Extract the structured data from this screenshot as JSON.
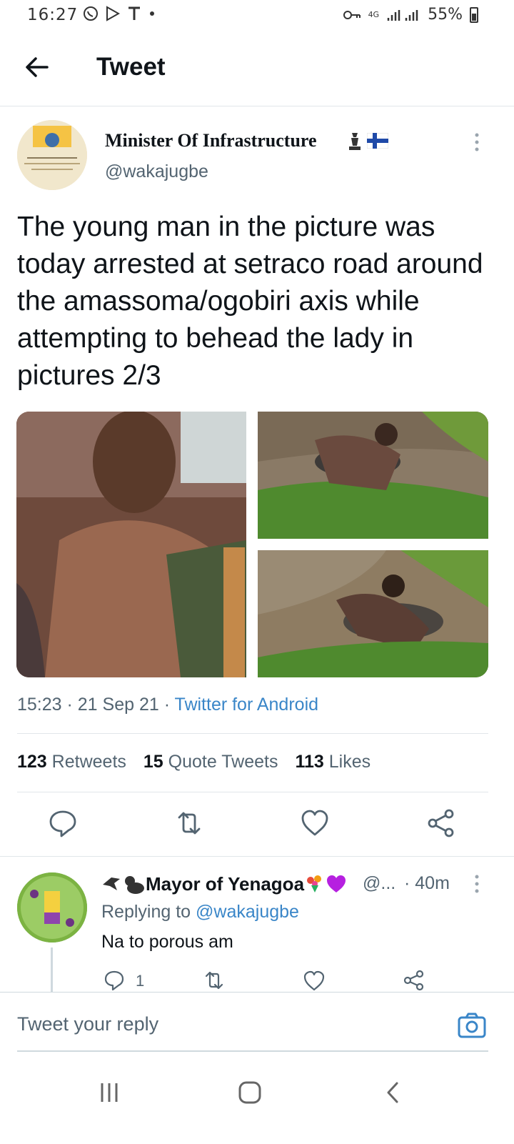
{
  "status_bar": {
    "time": "16:27",
    "network": "4G",
    "battery": "55%"
  },
  "header": {
    "title": "Tweet"
  },
  "tweet": {
    "author_name": "Minister Of Infrastructure",
    "author_handle": "@wakajugbe",
    "text": "The young man in the picture was today arrested at setraco road around the amassoma/ogobiri axis while attempting to behead the lady in pictures 2/3",
    "time": "15:23 · 21 Sep 21 · ",
    "source": "Twitter for Android",
    "stats": {
      "retweets_count": "123",
      "retweets_label": "Retweets",
      "quotes_count": "15",
      "quotes_label": "Quote Tweets",
      "likes_count": "113",
      "likes_label": "Likes"
    }
  },
  "reply": {
    "name": "Mayor of Yenagoa",
    "handle": "@...",
    "time": "· 40m",
    "replying_prefix": "Replying to ",
    "replying_to": "@wakajugbe",
    "text": "Na to porous am",
    "reply_count": "1"
  },
  "compose": {
    "placeholder": "Tweet your reply"
  },
  "icons": {
    "back": "arrow-left-icon",
    "more": "more-vertical-icon",
    "reply": "reply-icon",
    "retweet": "retweet-icon",
    "like": "heart-icon",
    "share": "share-icon",
    "camera": "camera-icon"
  },
  "colors": {
    "link": "#3a86c8",
    "secondary_text": "#536471",
    "divider": "#e1e6ea"
  }
}
